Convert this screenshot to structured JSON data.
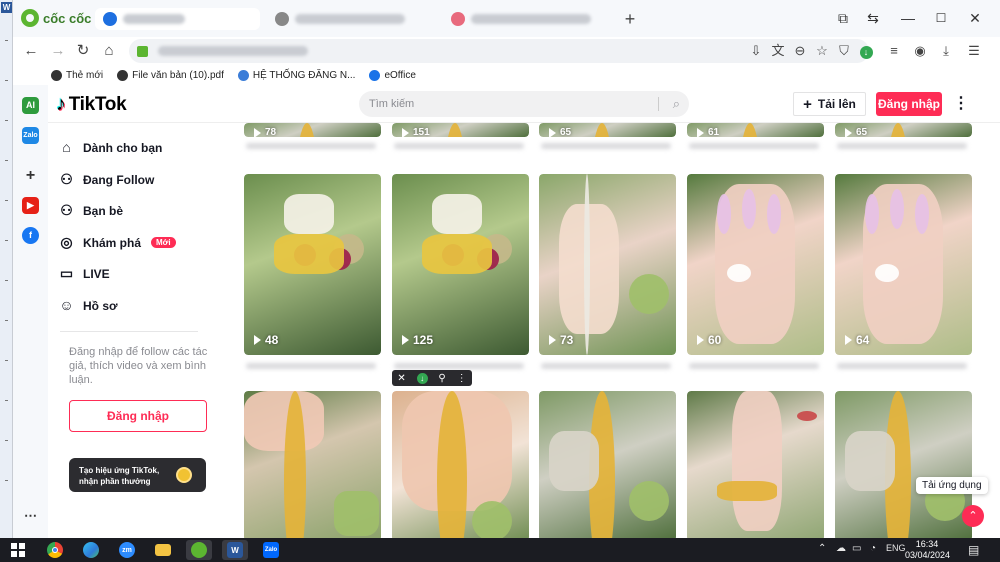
{
  "browser": {
    "brand": "cốc cốc",
    "bookmarks": [
      {
        "label": "Thẻ mới",
        "color": "#333"
      },
      {
        "label": "File văn bản (10).pdf",
        "color": "#333"
      },
      {
        "label": "HỆ THỐNG ĐĂNG N...",
        "color": "#3b7dd8"
      },
      {
        "label": "eOffice",
        "color": "#1a73e8"
      }
    ],
    "window_controls": [
      "—",
      "☐",
      "✕"
    ]
  },
  "rail": [
    {
      "icon": "ai-icon",
      "label": "AI",
      "color": "#2e9b3d"
    },
    {
      "icon": "zalo-icon",
      "label": "Zalo",
      "color": "#1e88e5"
    },
    {
      "icon": "add-icon",
      "label": "+",
      "color": "#f6f8fb"
    },
    {
      "icon": "youtube-icon",
      "label": "▶",
      "color": "#e62117"
    },
    {
      "icon": "facebook-icon",
      "label": "f",
      "color": "#1877f2"
    }
  ],
  "tiktok": {
    "logo": "TikTok",
    "search_placeholder": "Tìm kiếm",
    "upload_label": "Tải lên",
    "login_label": "Đăng nhập",
    "nav": [
      {
        "icon": "home-icon",
        "glyph": "⌂",
        "label": "Dành cho bạn"
      },
      {
        "icon": "following-icon",
        "glyph": "⚇",
        "label": "Đang Follow"
      },
      {
        "icon": "friends-icon",
        "glyph": "⚇",
        "label": "Bạn bè"
      },
      {
        "icon": "explore-icon",
        "glyph": "◎",
        "label": "Khám phá"
      },
      {
        "icon": "live-icon",
        "glyph": "▭",
        "label": "LIVE"
      },
      {
        "icon": "profile-icon",
        "glyph": "☺",
        "label": "Hồ sơ"
      }
    ],
    "new_badge": "Mới",
    "nav_description": "Đăng nhập để follow các tác giả, thích video và xem bình luận.",
    "nav_login_label": "Đăng nhập",
    "effect_card": "Tạo hiệu ứng TikTok, nhận phần thưởng",
    "row_top_views": [
      "78",
      "151",
      "65",
      "61",
      "65"
    ],
    "videos_row1": [
      {
        "views": "48",
        "theme": "earrings"
      },
      {
        "views": "125",
        "theme": "earrings"
      },
      {
        "views": "73",
        "theme": "ring-pearl"
      },
      {
        "views": "60",
        "theme": "ring-hand"
      },
      {
        "views": "64",
        "theme": "ring-hand"
      }
    ],
    "videos_row2": [
      {
        "theme": "gold-chain"
      },
      {
        "theme": "gold-bracelet"
      },
      {
        "theme": "gold-rope"
      },
      {
        "theme": "gold-links"
      },
      {
        "theme": "gold-rope"
      }
    ],
    "app_tooltip": "Tải ứng dụng"
  },
  "taskbar": {
    "apps": [
      {
        "icon": "windows-start-icon"
      },
      {
        "icon": "chrome-icon"
      },
      {
        "icon": "edge-icon"
      },
      {
        "icon": "zoom-icon",
        "label": "zm"
      },
      {
        "icon": "file-explorer-icon"
      },
      {
        "icon": "coccoc-icon"
      },
      {
        "icon": "word-icon",
        "label": "W"
      },
      {
        "icon": "zalo-icon",
        "label": "Zalo"
      }
    ],
    "language": "ENG",
    "time": "16:34",
    "date": "03/04/2024"
  }
}
